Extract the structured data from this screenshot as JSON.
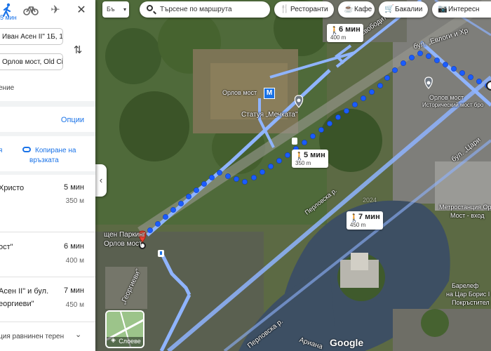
{
  "travel_modes": {
    "walk_time": "5 мин"
  },
  "route_inputs": {
    "origin": "Иван Асен II\" 1Б, 1",
    "destination": "Орлов мост, Old Ci"
  },
  "route_hint": "ение",
  "options_label": "Опции",
  "share": {
    "left_label": "я",
    "copy_label_line1": "Копиране на",
    "copy_label_line2": "връзката"
  },
  "steps": [
    {
      "name_line1": "Христо",
      "name_line2": "",
      "time": "5 мин",
      "distance": "350 м"
    },
    {
      "name_line1": "ост\"",
      "name_line2": "",
      "time": "6 мин",
      "distance": "400 м"
    },
    {
      "name_line1": "Асен II\" и бул.",
      "name_line2": "еоргиеви\"",
      "time": "7 мин",
      "distance": "450 м"
    }
  ],
  "footer_text": "ция равнинен терен",
  "top_bar": {
    "language": "Бъ",
    "search_placeholder": "Търсене по маршрута",
    "chips": [
      "Ресторанти",
      "Кафе",
      "Бакалии",
      "Интересн"
    ]
  },
  "walk_boxes": [
    {
      "time": "6 мин",
      "distance": "400 m"
    },
    {
      "time": "5 мин",
      "distance": "350 m"
    },
    {
      "time": "7 мин",
      "distance": "450 m"
    }
  ],
  "map_labels": {
    "orlov_most": "Орлов мост",
    "metro_letter": "M",
    "statue": "Статуя „Мечката\"",
    "parking_line1": "щен Паркинг",
    "parking_line2": "Орлов мост",
    "perlovska_1": "Перловска р.",
    "perlovska_2": "Перловска р.",
    "svoboditel": "„Освободител\"",
    "evlogi": "бул. „Евлоги и Хр",
    "orlov_most_right": "Орлов мост",
    "historical": "Исторический мост бро",
    "tsar": "бул. „Цари",
    "metro_station_1": "Метростанция Орл",
    "metro_station_2": "Мост - вход",
    "barelef_1": "Барелеф",
    "barelef_2": "на Цар Борис I",
    "barelef_3": "Покръстител",
    "georgievi": "„Георгиеви\"",
    "ariana": "Ариана",
    "year": "2024",
    "google": "Google"
  },
  "layers_label": "Слоеве",
  "colors": {
    "route_blue": "#1a5cff",
    "road_blue": "#8fb4ff",
    "accent": "#1a73e8",
    "pin_red": "#ea4335",
    "water": "#3d4f63"
  }
}
